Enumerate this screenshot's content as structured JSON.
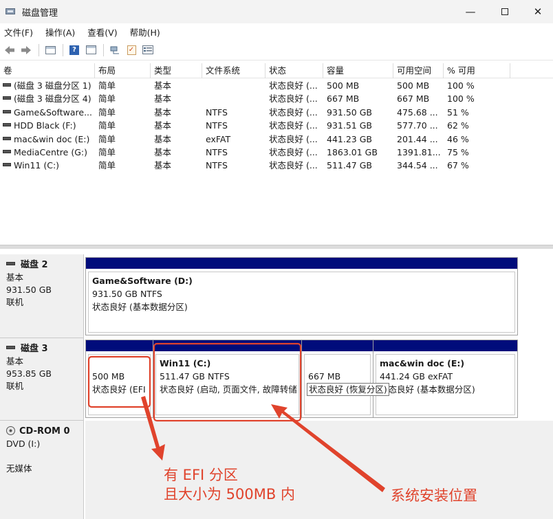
{
  "window": {
    "title": "磁盘管理",
    "controls": {
      "minimize": "—",
      "close": "✕"
    }
  },
  "menu": [
    "文件(F)",
    "操作(A)",
    "查看(V)",
    "帮助(H)"
  ],
  "toolbar": [
    "back-icon",
    "forward-icon",
    "console-icon",
    "help-icon",
    "properties-icon",
    "connect-icon",
    "check-icon",
    "list-icon"
  ],
  "table": {
    "headers": [
      "卷",
      "布局",
      "类型",
      "文件系统",
      "状态",
      "容量",
      "可用空间",
      "% 可用"
    ],
    "rows": [
      [
        "(磁盘 3 磁盘分区 1)",
        "简单",
        "基本",
        "",
        "状态良好 (...",
        "500 MB",
        "500 MB",
        "100 %"
      ],
      [
        "(磁盘 3 磁盘分区 4)",
        "简单",
        "基本",
        "",
        "状态良好 (...",
        "667 MB",
        "667 MB",
        "100 %"
      ],
      [
        "Game&Software...",
        "简单",
        "基本",
        "NTFS",
        "状态良好 (...",
        "931.50 GB",
        "475.68 ...",
        "51 %"
      ],
      [
        "HDD Black (F:)",
        "简单",
        "基本",
        "NTFS",
        "状态良好 (...",
        "931.51 GB",
        "577.70 ...",
        "62 %"
      ],
      [
        "mac&win doc (E:)",
        "简单",
        "基本",
        "exFAT",
        "状态良好 (...",
        "441.23 GB",
        "201.44 ...",
        "46 %"
      ],
      [
        "MediaCentre (G:)",
        "简单",
        "基本",
        "NTFS",
        "状态良好 (...",
        "1863.01 GB",
        "1391.81...",
        "75 %"
      ],
      [
        "Win11 (C:)",
        "简单",
        "基本",
        "NTFS",
        "状态良好 (...",
        "511.47 GB",
        "344.54 ...",
        "67 %"
      ]
    ]
  },
  "disks": [
    {
      "name": "磁盘 2",
      "type": "基本",
      "size": "931.50 GB",
      "status": "联机",
      "partitions": [
        {
          "name": "Game&Software  (D:)",
          "size_fs": "931.50 GB NTFS",
          "status": "状态良好 (基本数据分区)"
        }
      ]
    },
    {
      "name": "磁盘 3",
      "type": "基本",
      "size": "953.85 GB",
      "status": "联机",
      "partitions": [
        {
          "name": "",
          "size_fs": "500 MB",
          "status": "状态良好 (EFI"
        },
        {
          "name": "Win11  (C:)",
          "size_fs": "511.47 GB NTFS",
          "status": "状态良好 (启动, 页面文件, 故障转储"
        },
        {
          "name": "",
          "size_fs": "667 MB",
          "status": "状态良好 (恢复分区)"
        },
        {
          "name": "mac&win doc  (E:)",
          "size_fs": "441.24 GB exFAT",
          "status": "状态良好 (基本数据分区)"
        }
      ]
    },
    {
      "name": "CD-ROM 0",
      "type": "DVD (I:)",
      "status": "无媒体"
    }
  ],
  "annotations": {
    "efi_note_line1": "有 EFI 分区",
    "efi_note_line2": "且大小为 500MB 内",
    "system_note": "系统安装位置",
    "color": "#e0432c"
  }
}
